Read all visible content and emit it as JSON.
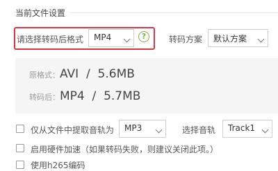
{
  "section": {
    "title": "当前文件设置"
  },
  "format": {
    "label": "请选择转码后格式",
    "selected": "MP4",
    "help": "?"
  },
  "scheme": {
    "label": "转码方案",
    "selected": "默认方案"
  },
  "info": {
    "original_label": "原格式：",
    "original_value": "AVI  /  5.6MB",
    "converted_label": "转码后：",
    "converted_value": "MP4  /  5.7MB"
  },
  "options": {
    "extract_audio_label": "仅从文件中提取音轨为",
    "audio_format": "MP3",
    "select_track_label": "选择音轨",
    "track": "Track1",
    "hw_accel_label": "启用硬件加速（如果转码失败，则建议关闭此项。）",
    "h265_label": "使用h265编码"
  },
  "colors": {
    "highlight": "#d9363e",
    "help_icon": "#7cb342",
    "panel_bg": "#f5f5f5"
  }
}
